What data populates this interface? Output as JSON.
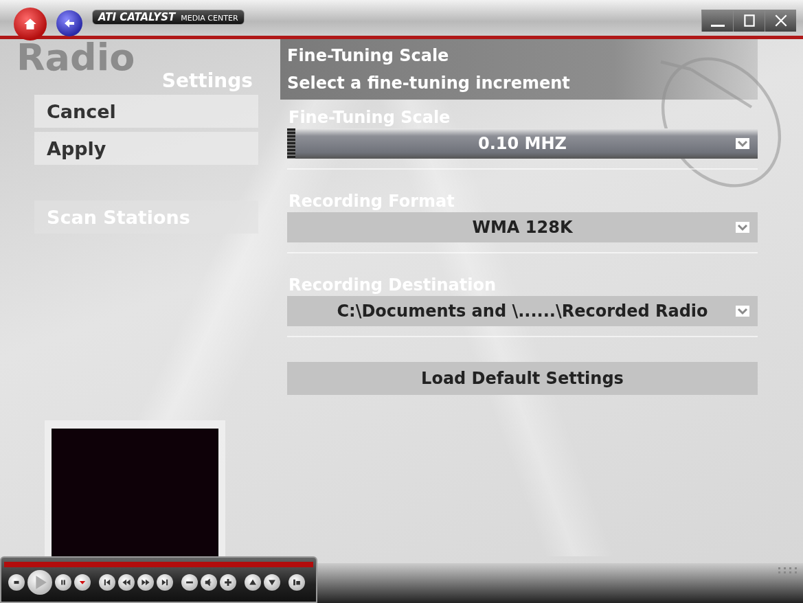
{
  "app": {
    "logo_brand": "ATI CATALYST",
    "logo_product": "MEDIA CENTER",
    "page_title": "Radio"
  },
  "window_controls": [
    {
      "kind": "minimize"
    },
    {
      "kind": "maximize"
    },
    {
      "kind": "close"
    }
  ],
  "nav": [
    {
      "kind": "home"
    },
    {
      "kind": "back"
    }
  ],
  "sidebar": {
    "heading": "Settings",
    "items": [
      {
        "label": "Cancel",
        "gap_before": false
      },
      {
        "label": "Apply",
        "gap_before": false
      },
      {
        "label": "Scan Stations",
        "gap_before": true
      }
    ]
  },
  "header": {
    "title": "Fine-Tuning Scale",
    "subtitle": "Select a fine-tuning increment"
  },
  "settings": [
    {
      "label": "Fine-Tuning Scale",
      "value": "0.10 MHZ",
      "focused": true
    },
    {
      "label": "Recording Format",
      "value": "WMA 128K",
      "focused": false
    },
    {
      "label": "Recording Destination",
      "value": "C:\\Documents and \\......\\Recorded Radio",
      "focused": false
    }
  ],
  "default_button": "Load Default Settings",
  "player": {
    "buttons": [
      {
        "kind": "stop"
      },
      {
        "kind": "play"
      },
      {
        "kind": "pause"
      },
      {
        "kind": "record"
      },
      {
        "kind": "first"
      },
      {
        "kind": "rewind"
      },
      {
        "kind": "forward"
      },
      {
        "kind": "last"
      },
      {
        "kind": "minus"
      },
      {
        "kind": "mute"
      },
      {
        "kind": "plus"
      },
      {
        "kind": "up"
      },
      {
        "kind": "down"
      },
      {
        "kind": "info"
      }
    ]
  }
}
